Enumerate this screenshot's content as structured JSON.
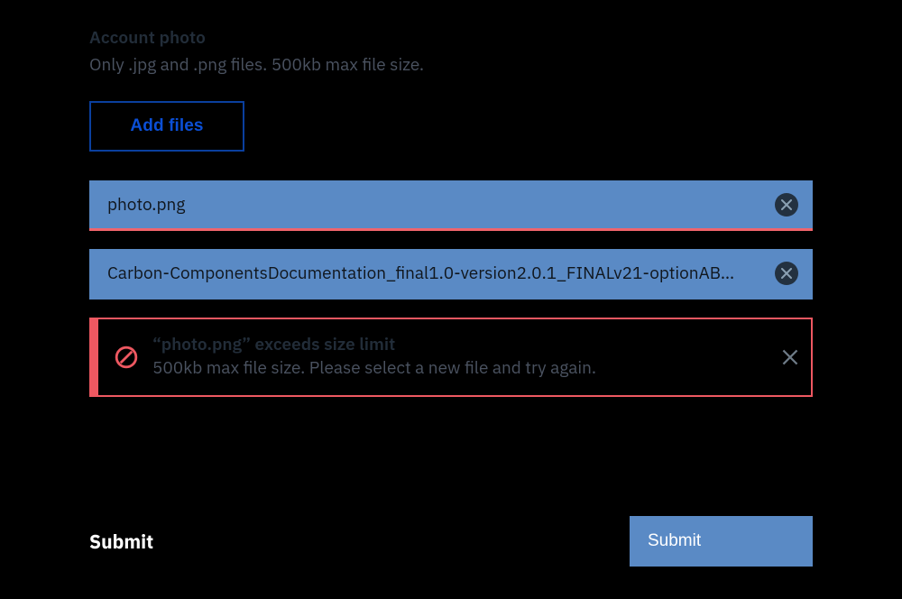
{
  "uploader": {
    "title": "Account photo",
    "hint": "Only .jpg and .png files. 500kb max file size.",
    "add_button": "Add files",
    "files": [
      {
        "name": "photo.png"
      },
      {
        "name": "Carbon-ComponentsDocumentation_final1.0-version2.0.1_FINALv21-optionAB…"
      }
    ],
    "error": {
      "title": "“photo.png” exceeds size limit",
      "subtitle": "500kb max file size. Please select a new file and try again."
    }
  },
  "footer": {
    "label": "Submit",
    "submit_button": "Submit"
  },
  "colors": {
    "tile": "#5a8ac5",
    "error": "#ee5861",
    "accent": "#0f62fe"
  }
}
